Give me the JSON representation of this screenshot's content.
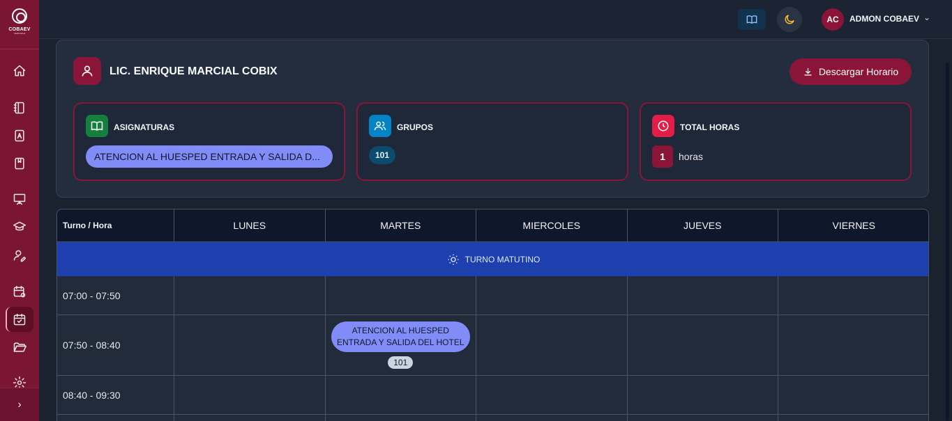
{
  "sidebar": {
    "logo_text": "COBAEV",
    "logo_sub": "VERACRUZ",
    "items": [
      {
        "icon": "home-icon"
      },
      {
        "icon": "notebook-icon"
      },
      {
        "icon": "contact-book-icon"
      },
      {
        "icon": "bookmark-book-icon"
      },
      {
        "icon": "presentation-icon"
      },
      {
        "icon": "graduation-cap-icon"
      },
      {
        "icon": "user-edit-icon"
      },
      {
        "icon": "calendar-settings-icon"
      },
      {
        "icon": "calendar-check-icon",
        "active": true
      },
      {
        "icon": "folder-open-icon"
      },
      {
        "icon": "settings-icon"
      }
    ],
    "expand_icon": "chevron-right-icon"
  },
  "header": {
    "book_icon": "book-open-icon",
    "theme_icon": "moon-icon",
    "avatar_initials": "AC",
    "user_name": "ADMON COBAEV"
  },
  "teacher": {
    "name": "LIC. ENRIQUE MARCIAL COBIX",
    "download_label": "Descargar Horario"
  },
  "stats": {
    "subjects_title": "ASIGNATURAS",
    "subject_value": "ATENCION AL HUESPED ENTRADA Y SALIDA D...",
    "groups_title": "GRUPOS",
    "group_value": "101",
    "hours_title": "TOTAL HORAS",
    "hours_value": "1",
    "hours_unit": "horas"
  },
  "schedule": {
    "corner_label": "Turno / Hora",
    "days": [
      "LUNES",
      "MARTES",
      "MIERCOLES",
      "JUEVES",
      "VIERNES"
    ],
    "shift_label": "TURNO MATUTINO",
    "slots": [
      {
        "time": "07:00 - 07:50"
      },
      {
        "time": "07:50 - 08:40",
        "class": {
          "day": "MARTES",
          "name": "ATENCION AL HUESPED ENTRADA Y SALIDA DEL HOTEL",
          "group": "101"
        }
      },
      {
        "time": "08:40 - 09:30"
      }
    ]
  },
  "colors": {
    "brand": "#8a1538",
    "shift_bar": "#1e40af",
    "class_pill": "#818cf8"
  }
}
